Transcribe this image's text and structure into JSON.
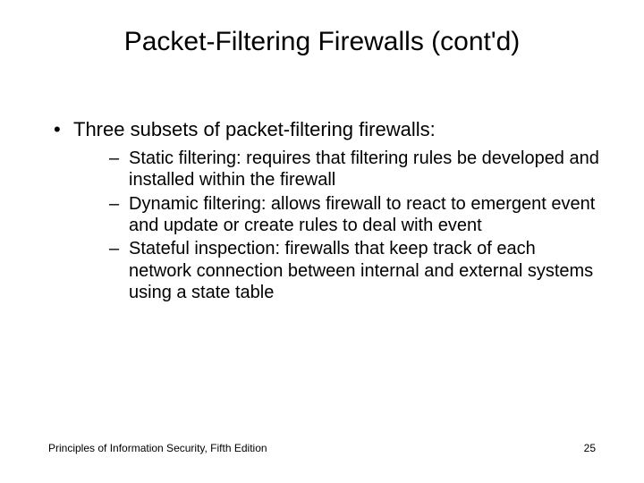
{
  "slide": {
    "title": "Packet-Filtering Firewalls (cont'd)",
    "bullet": "Three subsets of packet-filtering firewalls:",
    "subbullets": [
      "Static filtering: requires that filtering rules be developed and installed within the firewall",
      "Dynamic filtering: allows firewall to react to emergent event and update or create rules to deal with event",
      "Stateful inspection: firewalls that keep track of each network connection between internal and external systems using a state table"
    ],
    "footer_left": "Principles of Information Security, Fifth Edition",
    "footer_right": "25"
  }
}
